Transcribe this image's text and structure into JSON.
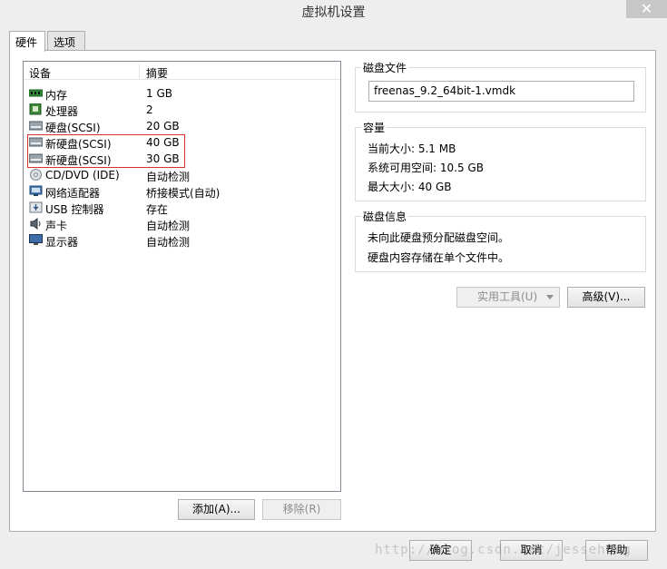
{
  "window": {
    "title": "虚拟机设置",
    "close_glyph": "✕"
  },
  "tabs": [
    {
      "label": "硬件"
    },
    {
      "label": "选项"
    }
  ],
  "devices": {
    "header": {
      "device": "设备",
      "summary": "摘要"
    },
    "rows": [
      {
        "name": "内存",
        "summary": "1 GB",
        "icon": "memory-icon"
      },
      {
        "name": "处理器",
        "summary": "2",
        "icon": "processor-icon"
      },
      {
        "name": "硬盘(SCSI)",
        "summary": "20 GB",
        "icon": "hard-disk-icon"
      },
      {
        "name": "新硬盘(SCSI)",
        "summary": "40 GB",
        "icon": "hard-disk-icon"
      },
      {
        "name": "新硬盘(SCSI)",
        "summary": "30 GB",
        "icon": "hard-disk-icon"
      },
      {
        "name": "CD/DVD (IDE)",
        "summary": "自动检测",
        "icon": "cd-dvd-icon"
      },
      {
        "name": "网络适配器",
        "summary": "桥接模式(自动)",
        "icon": "network-adapter-icon"
      },
      {
        "name": "USB 控制器",
        "summary": "存在",
        "icon": "usb-controller-icon"
      },
      {
        "name": "声卡",
        "summary": "自动检测",
        "icon": "sound-card-icon"
      },
      {
        "name": "显示器",
        "summary": "自动检测",
        "icon": "display-icon"
      }
    ],
    "add_button": "添加(A)...",
    "remove_button": "移除(R)"
  },
  "disk_file": {
    "title": "磁盘文件",
    "value": "freenas_9.2_64bit-1.vmdk"
  },
  "capacity": {
    "title": "容量",
    "current_size": "当前大小: 5.1 MB",
    "system_free": "系统可用空间: 10.5 GB",
    "max_size": "最大大小: 40 GB"
  },
  "disk_info": {
    "title": "磁盘信息",
    "line1": "未向此硬盘预分配磁盘空间。",
    "line2": "硬盘内容存储在单个文件中。"
  },
  "utilities_button": "实用工具(U)",
  "advanced_button": "高级(V)...",
  "footer": {
    "ok": "确定",
    "cancel": "取消",
    "help": "帮助"
  },
  "watermark": "http://blog.csdn.net/jessehung"
}
